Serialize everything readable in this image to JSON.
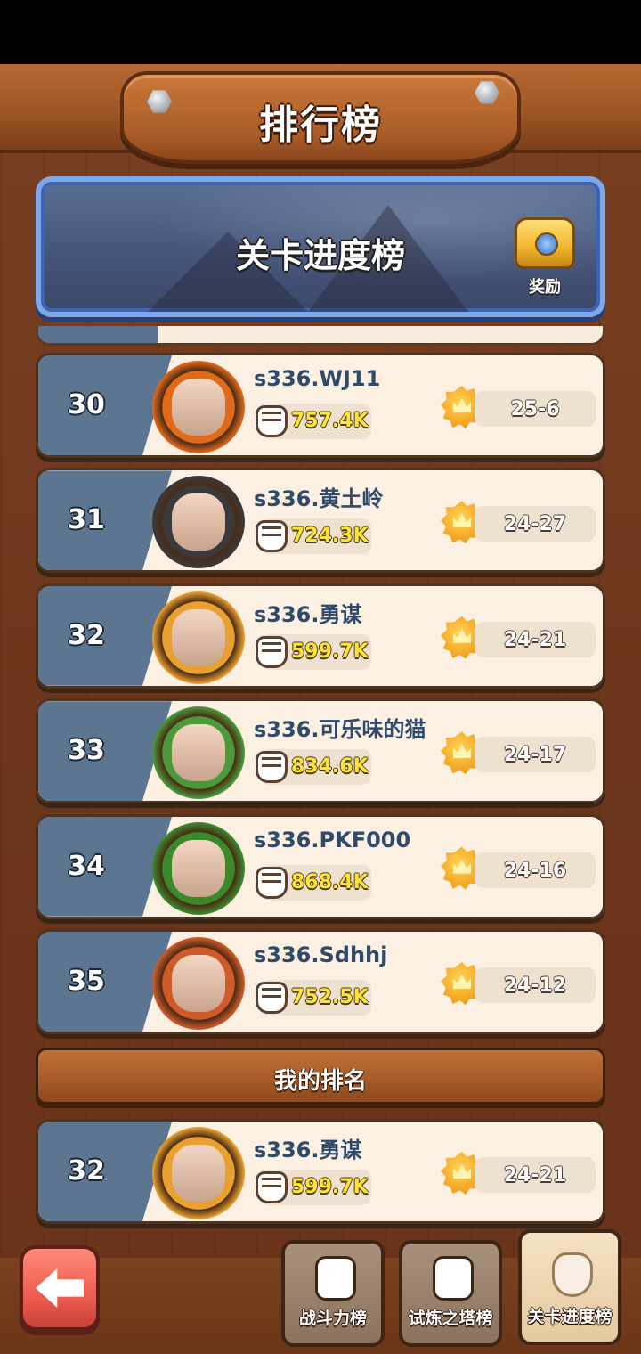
{
  "header": {
    "title": "排行榜"
  },
  "banner": {
    "title": "关卡进度榜",
    "reward_label": "奖励"
  },
  "rows": [
    {
      "rank": "30",
      "name": "s336.WJ11",
      "power": "757.4K",
      "stage": "25-6",
      "avatar_color": "#e06a1a"
    },
    {
      "rank": "31",
      "name": "s336.黄土岭",
      "power": "724.3K",
      "stage": "24-27",
      "avatar_color": "#3a3a3a"
    },
    {
      "rank": "32",
      "name": "s336.勇谋",
      "power": "599.7K",
      "stage": "24-21",
      "avatar_color": "#e8a030"
    },
    {
      "rank": "33",
      "name": "s336.可乐味的猫",
      "power": "834.6K",
      "stage": "24-17",
      "avatar_color": "#4a9a3a"
    },
    {
      "rank": "34",
      "name": "s336.PKF000",
      "power": "868.4K",
      "stage": "24-16",
      "avatar_color": "#3a8a2a"
    },
    {
      "rank": "35",
      "name": "s336.Sdhhj",
      "power": "752.5K",
      "stage": "24-12",
      "avatar_color": "#d05a2a"
    }
  ],
  "my_rank": {
    "label": "我的排名",
    "row": {
      "rank": "32",
      "name": "s336.勇谋",
      "power": "599.7K",
      "stage": "24-21",
      "avatar_color": "#e8a030"
    }
  },
  "tabs": [
    {
      "label": "战斗力榜",
      "icon": "fist-icon",
      "active": false
    },
    {
      "label": "试炼之塔榜",
      "icon": "tower-icon",
      "active": false
    },
    {
      "label": "关卡进度榜",
      "icon": "shield-icon",
      "active": true
    }
  ],
  "colors": {
    "rank_panel": "#5c7591",
    "power_text": "#ffe23a",
    "name_text": "#2f4a6a"
  }
}
